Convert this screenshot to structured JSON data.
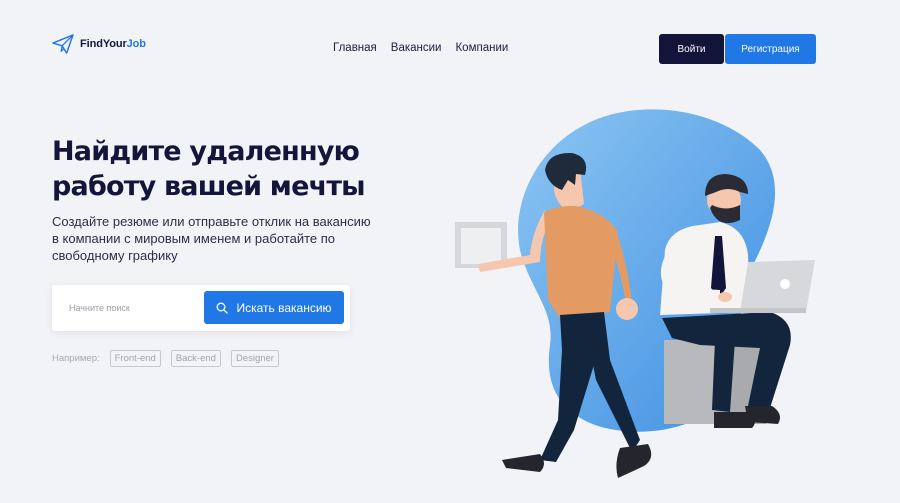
{
  "header": {
    "logo": {
      "text_main": "FindYour",
      "text_accent": "Job",
      "icon": "paper-plane-icon"
    },
    "nav": [
      {
        "label": "Главная"
      },
      {
        "label": "Вакансии"
      },
      {
        "label": "Компании"
      }
    ],
    "login_label": "Войти",
    "register_label": "Регистрация"
  },
  "hero": {
    "title": "Найдите удаленную работу вашей мечты",
    "subtitle": "Создайте резюме или отправьте отклик на вакансию в компании с мировым именем и работайте по свободному графику"
  },
  "search": {
    "placeholder": "Начните поиск",
    "button_label": "Искать вакансию",
    "button_icon": "search-icon"
  },
  "examples": {
    "label": "Например:",
    "tags": [
      "Front-end",
      "Back-end",
      "Designer"
    ]
  },
  "colors": {
    "background": "#f2f3f7",
    "primary": "#1f78e6",
    "dark": "#12143a",
    "blob": "#6fb0ea"
  }
}
